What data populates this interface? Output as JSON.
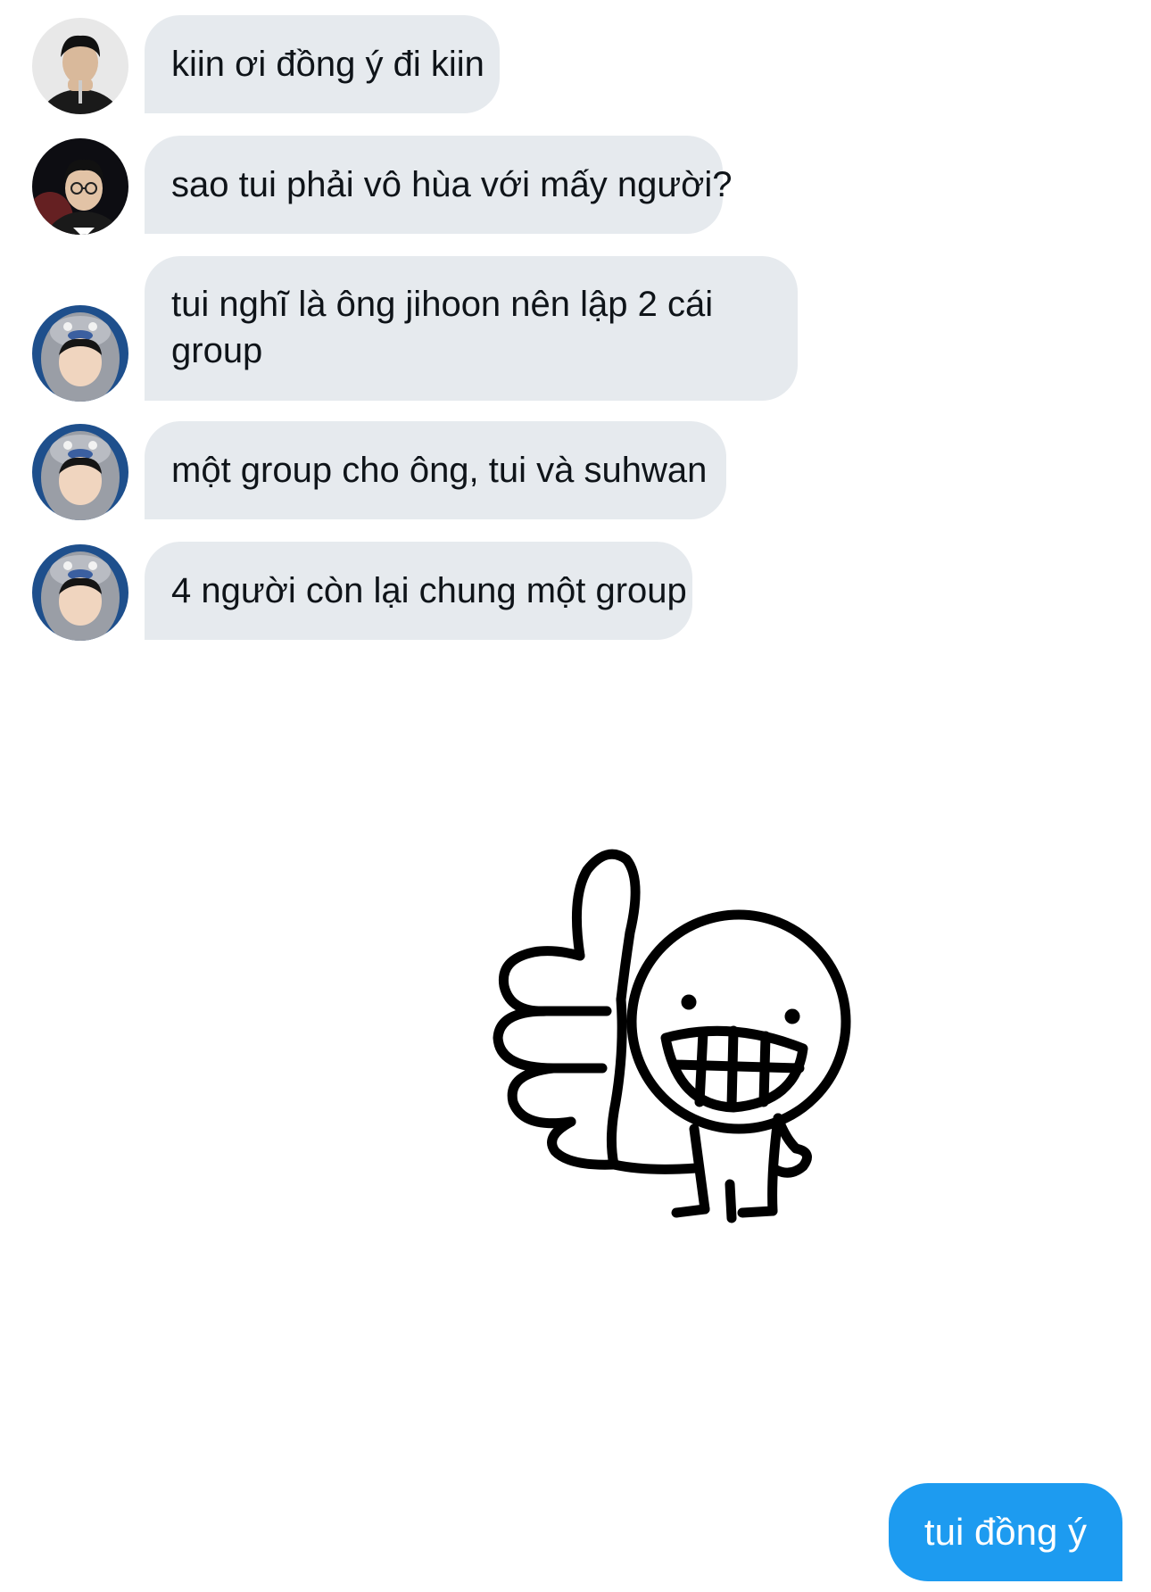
{
  "conversation": {
    "messages": [
      {
        "text": "kiin ơi đồng ý đi kiin",
        "avatar_icon": "user-avatar-1"
      },
      {
        "text": "sao tui phải vô hùa với mấy người?",
        "avatar_icon": "user-avatar-2"
      },
      {
        "text": "tui nghĩ là ông jihoon nên lập 2 cái group",
        "avatar_icon": "user-avatar-3"
      },
      {
        "text": "một group cho ông, tui và suhwan",
        "avatar_icon": "user-avatar-3"
      },
      {
        "text": "4 người còn lại chung một group",
        "avatar_icon": "user-avatar-3"
      }
    ],
    "sticker": {
      "icon": "thumbs-up-stick-figure-sticker"
    },
    "outgoing": {
      "text": "tui đồng ý"
    }
  },
  "colors": {
    "incoming_bubble": "#e6eaee",
    "outgoing_bubble": "#1d9bf0",
    "text": "#0f1419",
    "background": "#ffffff"
  }
}
